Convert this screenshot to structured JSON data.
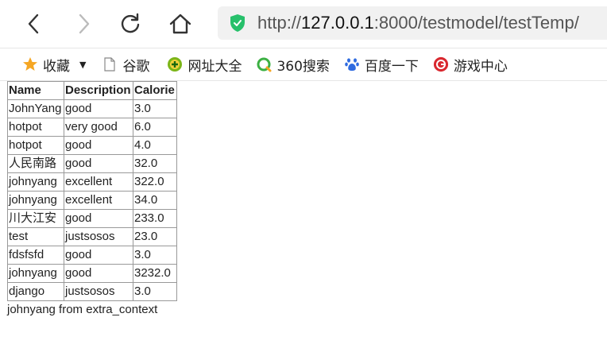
{
  "browser": {
    "url_prefix": "http://",
    "url_host": "127.0.0.1",
    "url_rest": ":8000/testmodel/testTemp/"
  },
  "bookmarks": {
    "favorites_label": "收藏",
    "items": [
      {
        "label": "谷歌",
        "icon": "page-icon"
      },
      {
        "label": "网址大全",
        "icon": "plus-circle-icon"
      },
      {
        "label": "360搜索",
        "icon": "360-search-icon"
      },
      {
        "label": "百度一下",
        "icon": "baidu-paw-icon"
      },
      {
        "label": "游戏中心",
        "icon": "game-center-icon"
      }
    ]
  },
  "table": {
    "headers": [
      "Name",
      "Description",
      "Calorie"
    ],
    "rows": [
      [
        "JohnYang",
        "good",
        "3.0"
      ],
      [
        "hotpot",
        "very good",
        "6.0"
      ],
      [
        "hotpot",
        "good",
        "4.0"
      ],
      [
        "人民南路",
        "good",
        "32.0"
      ],
      [
        "johnyang",
        "excellent",
        "322.0"
      ],
      [
        "johnyang",
        "excellent",
        "34.0"
      ],
      [
        "川大江安",
        "good",
        "233.0"
      ],
      [
        "test",
        "justsosos",
        "23.0"
      ],
      [
        "fdsfsfd",
        "good",
        "3.0"
      ],
      [
        "johnyang",
        "good",
        "3232.0"
      ],
      [
        "django",
        "justsosos",
        "3.0"
      ]
    ]
  },
  "extra_context": "johnyang from extra_context"
}
